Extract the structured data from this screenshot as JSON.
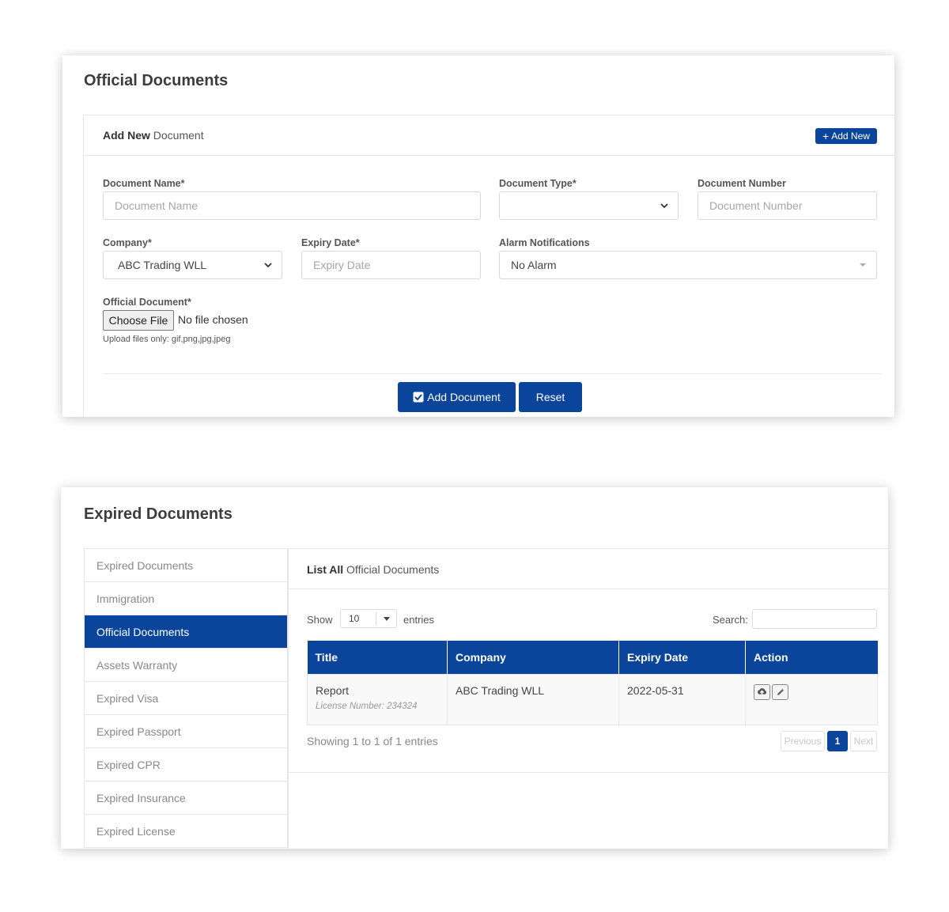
{
  "official": {
    "title": "Official Documents",
    "card_header_bold": "Add New",
    "card_header_rest": " Document",
    "add_new_label": "Add New",
    "fields": {
      "doc_name_label": "Document Name*",
      "doc_name_placeholder": "Document Name",
      "doc_type_label": "Document Type*",
      "doc_type_value": "",
      "doc_number_label": "Document Number",
      "doc_number_placeholder": "Document Number",
      "company_label": "Company*",
      "company_value": "ABC Trading WLL",
      "expiry_label": "Expiry Date*",
      "expiry_placeholder": "Expiry Date",
      "alarm_label": "Alarm Notifications",
      "alarm_value": "No Alarm",
      "file_label": "Official Document*",
      "file_button": "Choose File",
      "file_status": "No file chosen",
      "file_hint": "Upload files only: gif,png,jpg,jpeg"
    },
    "add_document_label": "Add Document",
    "reset_label": "Reset"
  },
  "expired": {
    "title": "Expired Documents",
    "sidebar": [
      {
        "label": "Expired Documents",
        "active": false
      },
      {
        "label": "Immigration",
        "active": false
      },
      {
        "label": "Official Documents",
        "active": true
      },
      {
        "label": "Assets Warranty",
        "active": false
      },
      {
        "label": "Expired Visa",
        "active": false
      },
      {
        "label": "Expired Passport",
        "active": false
      },
      {
        "label": "Expired CPR",
        "active": false
      },
      {
        "label": "Expired Insurance",
        "active": false
      },
      {
        "label": "Expired License",
        "active": false
      }
    ],
    "list_header_bold": "List All",
    "list_header_rest": " Official Documents",
    "show_label": "Show",
    "entries_label": "entries",
    "length_value": "10",
    "search_label": "Search:",
    "columns": [
      "Title",
      "Company",
      "Expiry Date",
      "Action"
    ],
    "rows": [
      {
        "title": "Report",
        "subtitle": "License Number: 234324",
        "company": "ABC Trading WLL",
        "expiry": "2022-05-31"
      }
    ],
    "info": "Showing 1 to 1 of 1 entries",
    "pager": {
      "previous": "Previous",
      "current": "1",
      "next": "Next"
    }
  },
  "colors": {
    "primary": "#0b449b"
  }
}
